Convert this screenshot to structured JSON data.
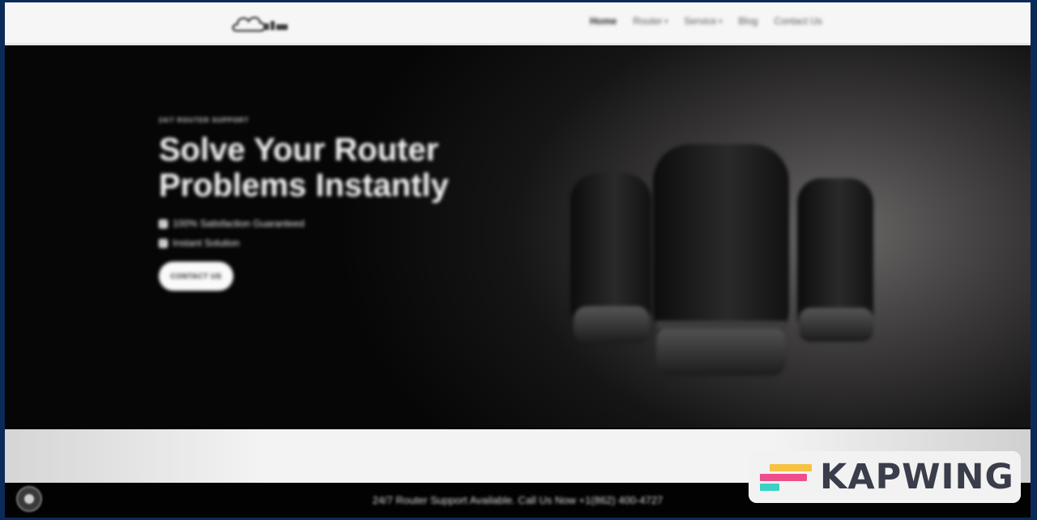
{
  "header": {
    "logo_alt": "site-logo",
    "nav": [
      {
        "label": "Home",
        "has_dropdown": false,
        "active": true
      },
      {
        "label": "Router",
        "has_dropdown": true,
        "active": false
      },
      {
        "label": "Service",
        "has_dropdown": true,
        "active": false
      },
      {
        "label": "Blog",
        "has_dropdown": false,
        "active": false
      },
      {
        "label": "Contact Us",
        "has_dropdown": false,
        "active": false
      }
    ]
  },
  "hero": {
    "eyebrow": "24/7 Router Support",
    "headline": "Solve Your Router Problems Instantly",
    "checks": [
      "100% Satisfaction Guaranteed",
      "Instant Solution"
    ],
    "cta_label": "CONTACT US"
  },
  "bottom_bar": {
    "text": "24/7 Router Support Available. Call Us Now +1(862) 400-4727"
  },
  "watermark": {
    "brand": "KAPWING",
    "colors": [
      "#f6c244",
      "#ee4e8b",
      "#3bd1c4"
    ]
  },
  "icons": {
    "check": "checkbox-icon",
    "chat": "chat-bubble-icon",
    "dropdown": "chevron-down-icon"
  }
}
